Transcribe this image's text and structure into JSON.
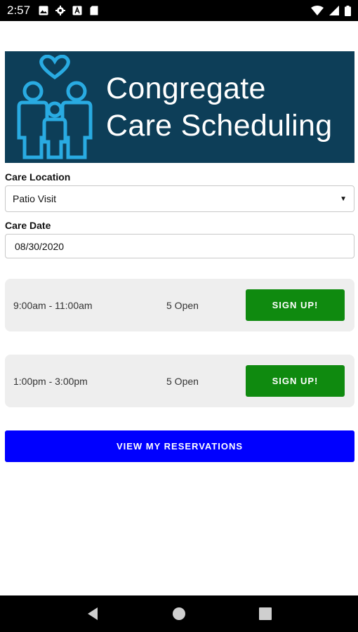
{
  "status_bar": {
    "time": "2:57",
    "left_icons": [
      "image-icon",
      "gear-icon",
      "font-icon",
      "sd-card-icon"
    ],
    "right_icons": [
      "wifi-icon",
      "signal-icon",
      "battery-icon"
    ]
  },
  "banner": {
    "title_line1": "Congregate",
    "title_line2": "Care Scheduling",
    "logo": "family-heart-logo"
  },
  "form": {
    "location_label": "Care Location",
    "location_value": "Patio Visit",
    "date_label": "Care Date",
    "date_value": "08/30/2020"
  },
  "slots": [
    {
      "time": "9:00am - 11:00am",
      "open": "5 Open",
      "button": "SIGN UP!"
    },
    {
      "time": "1:00pm - 3:00pm",
      "open": "5 Open",
      "button": "SIGN UP!"
    }
  ],
  "view_reservations_label": "VIEW MY RESERVATIONS",
  "colors": {
    "banner_bg": "#0d3e58",
    "logo_blue": "#29abe2",
    "signup_green": "#0f8a0f",
    "view_button_blue": "#0000ff"
  },
  "nav_bar": [
    "back-icon",
    "home-icon",
    "recents-icon"
  ]
}
